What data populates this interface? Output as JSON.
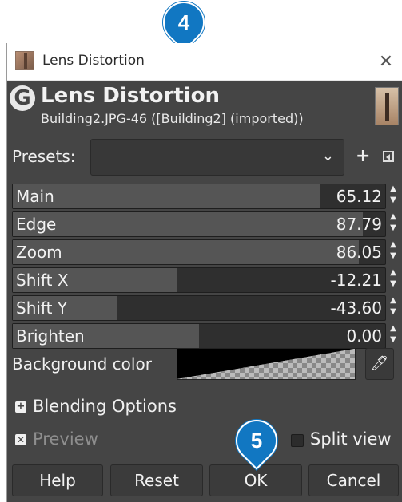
{
  "annotations": {
    "pin_top": "4",
    "pin_ok": "5"
  },
  "window": {
    "title": "Lens Distortion",
    "close_glyph": "✕"
  },
  "header": {
    "logo_glyph": "G",
    "title": "Lens Distortion",
    "subtitle": "Building2.JPG-46 ([Building2] (imported))"
  },
  "presets": {
    "label": "Presets:",
    "value": "",
    "chevron": "⌄",
    "add_glyph": "+"
  },
  "sliders": [
    {
      "label": "Main",
      "value": "65.12",
      "fill_percent": 82.5
    },
    {
      "label": "Edge",
      "value": "87.79",
      "fill_percent": 93.9
    },
    {
      "label": "Zoom",
      "value": "86.05",
      "fill_percent": 93.0
    },
    {
      "label": "Shift X",
      "value": "-12.21",
      "fill_percent": 43.9
    },
    {
      "label": "Shift Y",
      "value": "-43.60",
      "fill_percent": 28.2
    },
    {
      "label": "Brighten",
      "value": "0.00",
      "fill_percent": 50.0
    }
  ],
  "spin_glyphs": "▲▼",
  "background": {
    "label": "Background color",
    "color": "#000000"
  },
  "blending": {
    "toggle_glyph": "+",
    "label": "Blending Options"
  },
  "preview": {
    "check_glyph": "✕",
    "label": "Preview",
    "checked": true
  },
  "split_view": {
    "label": "Split view",
    "checked": false
  },
  "buttons": {
    "help": "Help",
    "reset": "Reset",
    "ok": "OK",
    "cancel": "Cancel"
  },
  "colors": {
    "dialog_bg": "#454545",
    "pin": "#1177c2"
  }
}
